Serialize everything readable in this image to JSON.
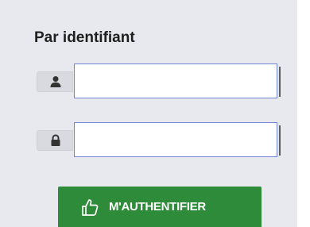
{
  "login": {
    "title": "Par identifiant",
    "username": {
      "value": "",
      "placeholder": "",
      "icon": "user-icon"
    },
    "password": {
      "value": "",
      "placeholder": "",
      "icon": "lock-icon"
    },
    "submit": {
      "label": "M'AUTHENTIFIER",
      "icon": "thumbs-up-icon",
      "color": "#2e8b3a"
    }
  },
  "colors": {
    "panel_background": "#e8e9ee",
    "input_border": "#6f86d6",
    "addon_background": "#d9dadf"
  }
}
